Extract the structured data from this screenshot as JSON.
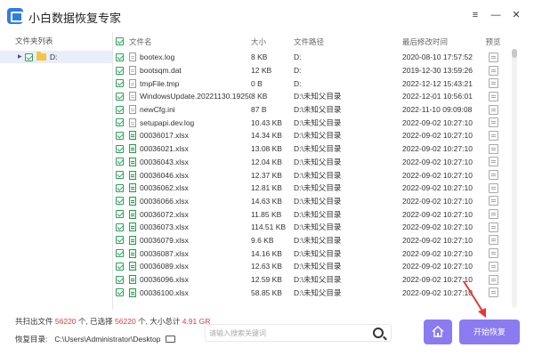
{
  "app": {
    "title": "小白数据恢复专家"
  },
  "window_controls": {
    "menu": "≡",
    "minimize": "—",
    "close": "✕"
  },
  "left_panel": {
    "header": "文件夹列表",
    "items": [
      {
        "label": "D:"
      }
    ]
  },
  "table": {
    "headers": {
      "name": "文件名",
      "size": "大小",
      "path": "文件路径",
      "modified": "最后修改时间",
      "preview": "预览"
    },
    "rows": [
      {
        "name": "bootex.log",
        "size": "8 KB",
        "path": "D:",
        "modified": "2020-08-10 17:57:52",
        "type": "file"
      },
      {
        "name": "bootsqm.dat",
        "size": "12 KB",
        "path": "D:",
        "modified": "2019-12-30 13:59:26",
        "type": "file"
      },
      {
        "name": "tmpFile.tmp",
        "size": "0 B",
        "path": "D:",
        "modified": "2022-12-12 15:43:21",
        "type": "file"
      },
      {
        "name": "WindowsUpdate.20221130.19250",
        "size": "8 KB",
        "path": "D:\\未知父目录",
        "modified": "2022-12-01 10:56:01",
        "type": "file"
      },
      {
        "name": "newCfg.ini",
        "size": "87 B",
        "path": "D:\\未知父目录",
        "modified": "2022-11-10 09:09:08",
        "type": "file"
      },
      {
        "name": "setupapi.dev.log",
        "size": "10.43 KB",
        "path": "D:\\未知父目录",
        "modified": "2022-09-02 10:27:10",
        "type": "file"
      },
      {
        "name": "00036017.xlsx",
        "size": "14.34 KB",
        "path": "D:\\未知父目录",
        "modified": "2022-09-02 10:27:10",
        "type": "xlsx"
      },
      {
        "name": "00036021.xlsx",
        "size": "13.08 KB",
        "path": "D:\\未知父目录",
        "modified": "2022-09-02 10:27:10",
        "type": "xlsx"
      },
      {
        "name": "00036043.xlsx",
        "size": "12.04 KB",
        "path": "D:\\未知父目录",
        "modified": "2022-09-02 10:27:10",
        "type": "xlsx"
      },
      {
        "name": "00036046.xlsx",
        "size": "12.37 KB",
        "path": "D:\\未知父目录",
        "modified": "2022-09-02 10:27:10",
        "type": "xlsx"
      },
      {
        "name": "00036062.xlsx",
        "size": "12.81 KB",
        "path": "D:\\未知父目录",
        "modified": "2022-09-02 10:27:10",
        "type": "xlsx"
      },
      {
        "name": "00036066.xlsx",
        "size": "14.63 KB",
        "path": "D:\\未知父目录",
        "modified": "2022-09-02 10:27:10",
        "type": "xlsx"
      },
      {
        "name": "00036072.xlsx",
        "size": "11.85 KB",
        "path": "D:\\未知父目录",
        "modified": "2022-09-02 10:27:10",
        "type": "xlsx"
      },
      {
        "name": "00036073.xlsx",
        "size": "114.51 KB",
        "path": "D:\\未知父目录",
        "modified": "2022-09-02 10:27:10",
        "type": "xlsx"
      },
      {
        "name": "00036079.xlsx",
        "size": "9.6 KB",
        "path": "D:\\未知父目录",
        "modified": "2022-09-02 10:27:10",
        "type": "xlsx"
      },
      {
        "name": "00036087.xlsx",
        "size": "14.16 KB",
        "path": "D:\\未知父目录",
        "modified": "2022-09-02 10:27:10",
        "type": "xlsx"
      },
      {
        "name": "00036089.xlsx",
        "size": "12.63 KB",
        "path": "D:\\未知父目录",
        "modified": "2022-09-02 10:27:10",
        "type": "xlsx"
      },
      {
        "name": "00036096.xlsx",
        "size": "12.59 KB",
        "path": "D:\\未知父目录",
        "modified": "2022-09-02 10:27:10",
        "type": "xlsx"
      },
      {
        "name": "00036100.xlsx",
        "size": "58.85 KB",
        "path": "D:\\未知父目录",
        "modified": "2022-09-02 10:27:10",
        "type": "xlsx"
      }
    ]
  },
  "status": {
    "scanned_label": "共扫出文件",
    "scanned_count": "56220",
    "unit1": "个,",
    "selected_label": "已选择",
    "selected_count": "56220",
    "unit2": "个,",
    "total_label": "大小总计",
    "total_size": "4.91 GR"
  },
  "recover_dir": {
    "label": "恢复目录:",
    "value": "C:\\Users\\Administrator\\Desktop"
  },
  "search": {
    "placeholder": "请输入搜索关键词"
  },
  "buttons": {
    "start": "开始恢复"
  },
  "colors": {
    "accent": "#8b7bf0",
    "highlight": "#e03b3b",
    "checkbox": "#2fa05a",
    "selection": "#e8eefc"
  }
}
